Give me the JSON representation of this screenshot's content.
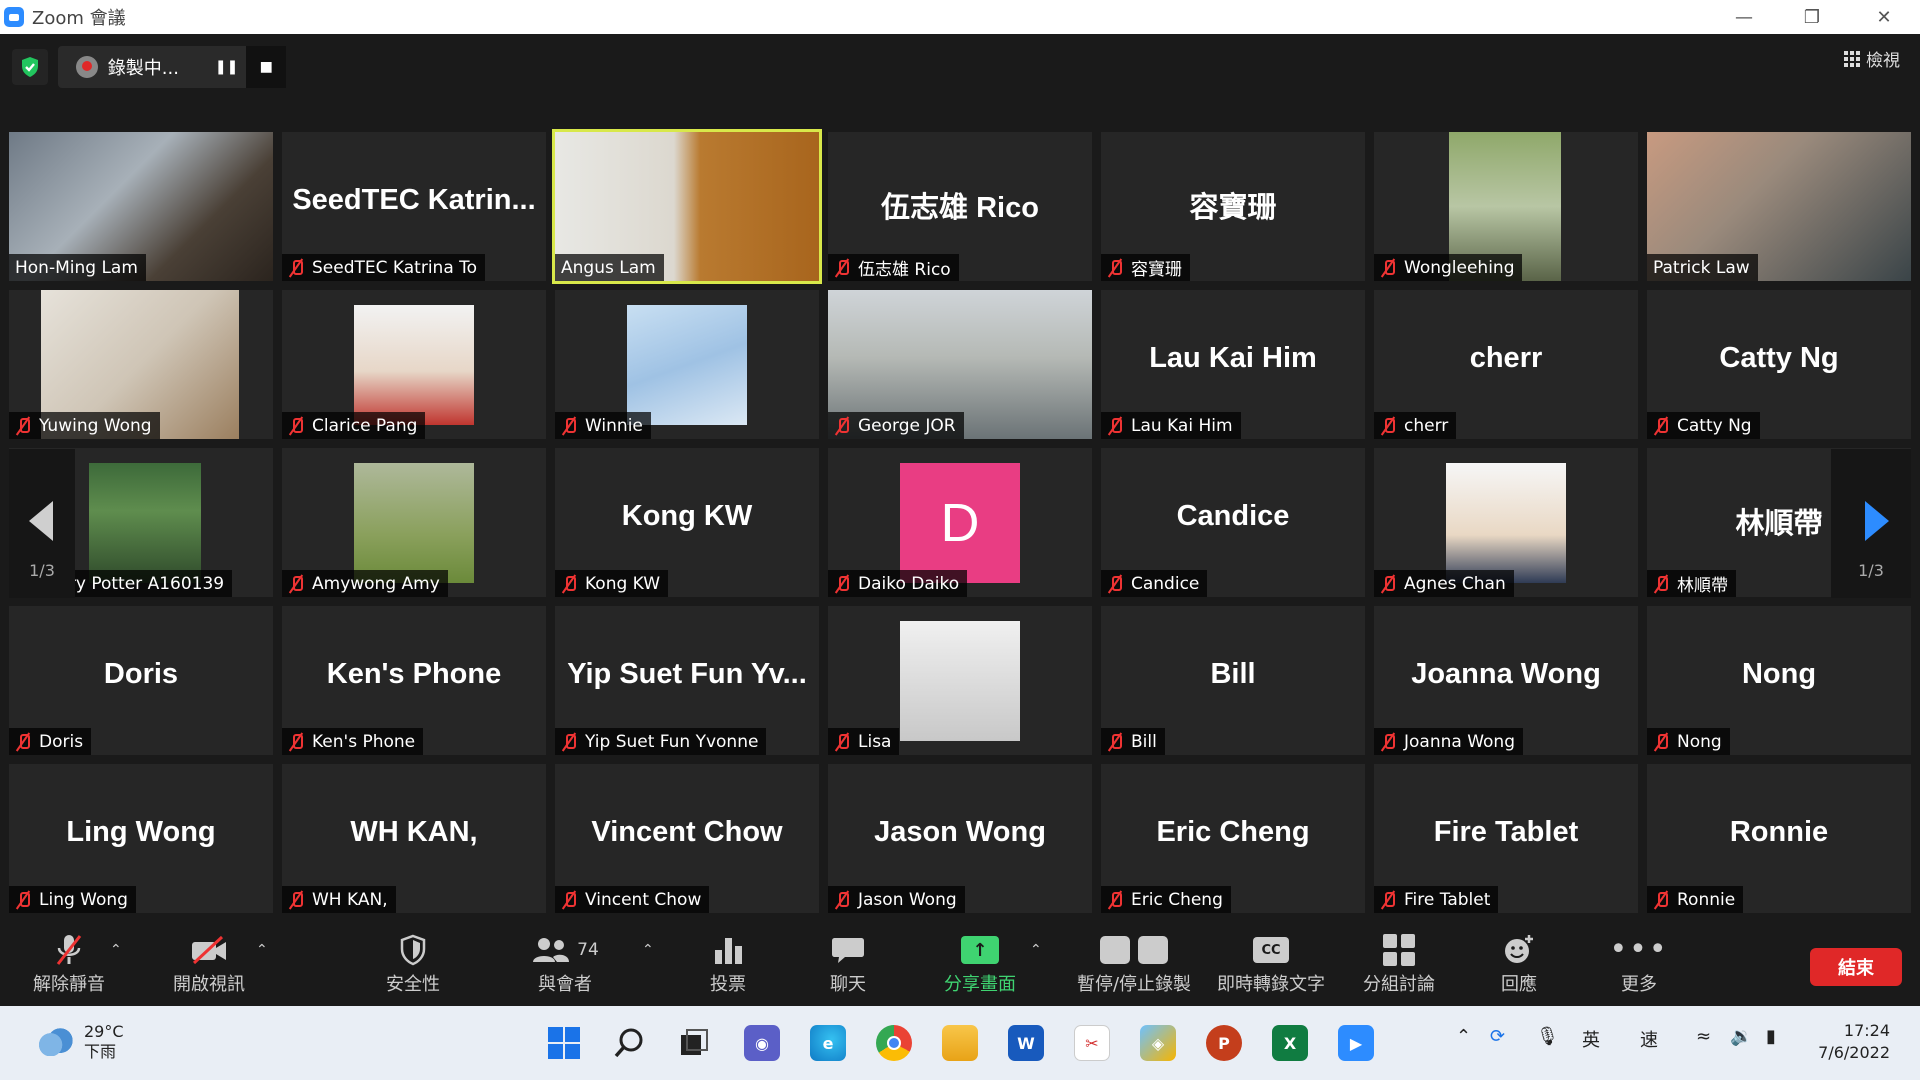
{
  "window": {
    "title": "Zoom 會議"
  },
  "top": {
    "recording_label": "錄製中...",
    "view_label": "檢視"
  },
  "grid": {
    "tiles": [
      {
        "big": "",
        "tag": "Hon-Ming Lam",
        "muted": false,
        "video": "v-hon"
      },
      {
        "big": "SeedTEC  Katrin...",
        "tag": "SeedTEC Katrina To",
        "muted": true
      },
      {
        "big": "",
        "tag": "Angus Lam",
        "muted": false,
        "video": "v-angus",
        "active": true
      },
      {
        "big": "伍志雄 Rico",
        "tag": "伍志雄 Rico",
        "muted": true
      },
      {
        "big": "容寶珊",
        "tag": "容寶珊",
        "muted": true
      },
      {
        "big": "",
        "tag": "Wongleehing",
        "muted": true,
        "video": "v-wong"
      },
      {
        "big": "",
        "tag": "Patrick Law",
        "muted": false,
        "video": "v-patrick"
      },
      {
        "big": "",
        "tag": "Yuwing Wong",
        "muted": true,
        "video": "v-yuwing"
      },
      {
        "big": "",
        "tag": "Clarice Pang",
        "muted": true,
        "video": "v-clarice"
      },
      {
        "big": "",
        "tag": "Winnie",
        "muted": true,
        "video": "v-winnie"
      },
      {
        "big": "",
        "tag": "George JOR",
        "muted": true,
        "video": "v-george"
      },
      {
        "big": "Lau Kai Him",
        "tag": "Lau Kai Him",
        "muted": true
      },
      {
        "big": "cherr",
        "tag": "cherr",
        "muted": true
      },
      {
        "big": "Catty Ng",
        "tag": "Catty Ng",
        "muted": true
      },
      {
        "big": "",
        "tag": "Harry Potter A160139",
        "muted": true,
        "video": "v-potter"
      },
      {
        "big": "",
        "tag": "Amywong Amy",
        "muted": true,
        "video": "v-amy"
      },
      {
        "big": "Kong KW",
        "tag": "Kong KW",
        "muted": true
      },
      {
        "big": "",
        "tag": "Daiko Daiko",
        "muted": true,
        "video": "v-daiko",
        "initial": "D"
      },
      {
        "big": "Candice",
        "tag": "Candice",
        "muted": true
      },
      {
        "big": "",
        "tag": "Agnes Chan",
        "muted": true,
        "video": "v-agnes"
      },
      {
        "big": "林順帶",
        "tag": "林順帶",
        "muted": true
      },
      {
        "big": "Doris",
        "tag": "Doris",
        "muted": true
      },
      {
        "big": "Ken's Phone",
        "tag": "Ken's Phone",
        "muted": true
      },
      {
        "big": "Yip Suet Fun Yv...",
        "tag": "Yip Suet Fun Yvonne",
        "muted": true
      },
      {
        "big": "",
        "tag": "Lisa",
        "muted": true,
        "video": "v-lisa"
      },
      {
        "big": "Bill",
        "tag": "Bill",
        "muted": true
      },
      {
        "big": "Joanna Wong",
        "tag": "Joanna Wong",
        "muted": true
      },
      {
        "big": "Nong",
        "tag": "Nong",
        "muted": true
      },
      {
        "big": "Ling Wong",
        "tag": "Ling Wong",
        "muted": true
      },
      {
        "big": "WH KAN,",
        "tag": "WH KAN,",
        "muted": true
      },
      {
        "big": "Vincent Chow",
        "tag": "Vincent Chow",
        "muted": true
      },
      {
        "big": "Jason Wong",
        "tag": "Jason Wong",
        "muted": true
      },
      {
        "big": "Eric Cheng",
        "tag": "Eric Cheng",
        "muted": true
      },
      {
        "big": "Fire Tablet",
        "tag": "Fire Tablet",
        "muted": true
      },
      {
        "big": "Ronnie",
        "tag": "Ronnie",
        "muted": true
      }
    ],
    "page_indicator": "1/3"
  },
  "toolbar": {
    "unmute": "解除靜音",
    "start_video": "開啟視訊",
    "security": "安全性",
    "participants": "與會者",
    "participant_count": "74",
    "polls": "投票",
    "chat": "聊天",
    "share_screen": "分享畫面",
    "pause_stop_recording": "暫停/停止錄製",
    "live_transcript": "即時轉錄文字",
    "breakout_rooms": "分組討論",
    "reactions": "回應",
    "more": "更多",
    "end": "結束",
    "cc": "CC"
  },
  "taskbar": {
    "temperature": "29°C",
    "weather_desc": "下雨",
    "ime_lang": "英",
    "ime_mode": "速",
    "time": "17:24",
    "date": "7/6/2022"
  },
  "colors": {
    "accent": "#2d8cff",
    "share_green": "#3fd371",
    "end_red": "#e02828",
    "active_speaker": "#d8e84a"
  }
}
